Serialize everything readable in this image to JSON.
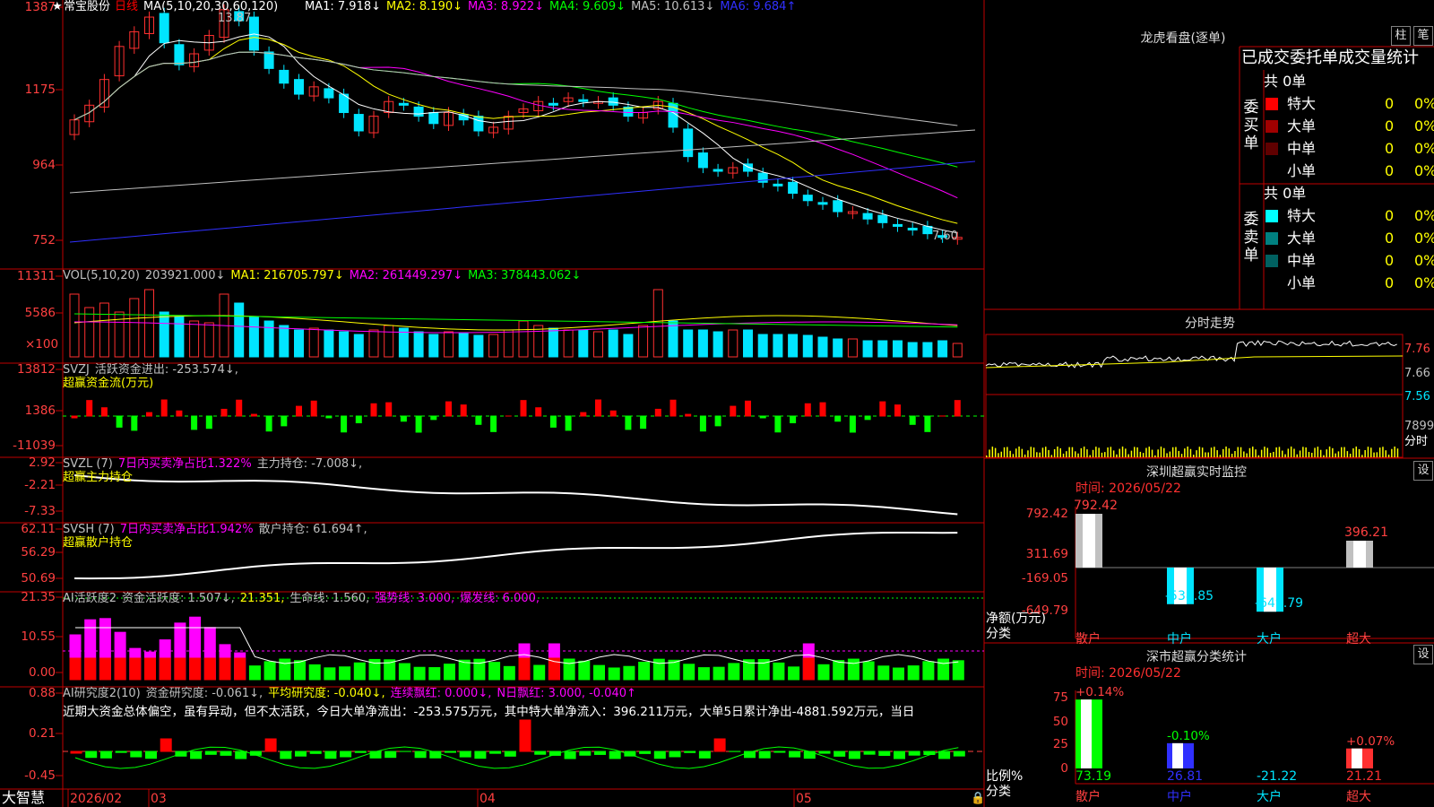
{
  "stock": {
    "name": "常宝股份",
    "period": "日线",
    "ma_header": "MA(5,10,20,30,60,120)",
    "ma_values": [
      {
        "label": "MA1: 7.918↓",
        "color": "#ffffff"
      },
      {
        "label": "MA2: 8.190↓",
        "color": "#ffff00"
      },
      {
        "label": "MA3: 8.922↓",
        "color": "#ff00ff"
      },
      {
        "label": "MA4: 9.609↓",
        "color": "#00ff00"
      },
      {
        "label": "MA5: 10.613↓",
        "color": "#c0c0c0"
      },
      {
        "label": "MA6: 9.684↑",
        "color": "#3030ff"
      }
    ],
    "high_label": "13.87",
    "low_label": "7.60"
  },
  "price_axis": [
    "1387",
    "1175",
    "964",
    "752"
  ],
  "vol_axis": [
    "11311",
    "5586",
    "×100"
  ],
  "vol_header": [
    {
      "label": "VOL(5,10,20)",
      "color": "#c0c0c0"
    },
    {
      "label": "203921.000↓",
      "color": "#c0c0c0"
    },
    {
      "label": "MA1: 216705.797↓",
      "color": "#ffff00"
    },
    {
      "label": "MA2: 261449.297↓",
      "color": "#ff00ff"
    },
    {
      "label": "MA3: 378443.062↓",
      "color": "#00ff00"
    }
  ],
  "svzj": {
    "axis": [
      "13812",
      "1386",
      "-11039"
    ],
    "header": [
      {
        "label": "SVZJ",
        "color": "#c0c0c0"
      },
      {
        "label": "活跃资金进出: -253.574↓,",
        "color": "#c0c0c0"
      }
    ],
    "sub": "超赢资金流(万元)"
  },
  "svzl": {
    "axis": [
      "2.92",
      "-2.21",
      "-7.33"
    ],
    "header": [
      {
        "label": "SVZL (7)",
        "color": "#c0c0c0"
      },
      {
        "label": "7日内买卖净占比1.322%",
        "color": "#ff00ff"
      },
      {
        "label": "主力持仓: -7.008↓,",
        "color": "#c0c0c0"
      }
    ],
    "sub": "超赢主力持仓"
  },
  "svsh": {
    "axis": [
      "62.11",
      "56.29",
      "50.69"
    ],
    "header": [
      {
        "label": "SVSH (7)",
        "color": "#c0c0c0"
      },
      {
        "label": "7日内买卖净占比1.942%",
        "color": "#ff00ff"
      },
      {
        "label": "散户持仓: 61.694↑,",
        "color": "#c0c0c0"
      }
    ],
    "sub": "超赢散户持仓"
  },
  "ai_active": {
    "axis": [
      "21.35",
      "10.55",
      "0.00"
    ],
    "header": [
      {
        "label": "AI活跃度2",
        "color": "#c0c0c0"
      },
      {
        "label": "资金活跃度: 1.507↓,",
        "color": "#c0c0c0"
      },
      {
        "label": "21.351,",
        "color": "#ffff00"
      },
      {
        "label": "生命线: 1.560,",
        "color": "#c0c0c0"
      },
      {
        "label": "强势线: 3.000,",
        "color": "#ff00ff"
      },
      {
        "label": "爆发线: 6.000,",
        "color": "#ff00ff"
      }
    ]
  },
  "ai_research": {
    "axis": [
      "0.88",
      "0.21",
      "-0.45"
    ],
    "header": [
      {
        "label": "AI研究度2(10)",
        "color": "#c0c0c0"
      },
      {
        "label": "资金研究度: -0.061↓,",
        "color": "#c0c0c0"
      },
      {
        "label": "平均研究度: -0.040↓,",
        "color": "#ffff00"
      },
      {
        "label": "连续飘红: 0.000↓,",
        "color": "#ff00ff"
      },
      {
        "label": "N日飘红: 3.000, -0.040↑",
        "color": "#ff00ff"
      }
    ],
    "text": "近期大资金总体偏空，虽有异动，但不太活跃，今日大单净流出：-253.575万元，其中特大单净流入：396.211万元，大单5日累计净出-4881.592万元，当日"
  },
  "dates": [
    "2026/02",
    "03",
    "04",
    "05"
  ],
  "brand": "大智慧",
  "lhb": {
    "title": "龙虎看盘(逐单)",
    "btn1": "柱",
    "btn2": "笔",
    "subtitle": "已成交委托单成交量统计",
    "buy_label": "委买单",
    "sell_label": "委卖单",
    "buy_total": "共 0单",
    "sell_total": "共 0单",
    "buy_rows": [
      {
        "name": "特大",
        "count": "0",
        "pct": "0%",
        "color": "#ff0000"
      },
      {
        "name": "大单",
        "count": "0",
        "pct": "0%",
        "color": "#a00000"
      },
      {
        "name": "中单",
        "count": "0",
        "pct": "0%",
        "color": "#600000"
      },
      {
        "name": "小单",
        "count": "0",
        "pct": "0%",
        "color": ""
      }
    ],
    "sell_rows": [
      {
        "name": "特大",
        "count": "0",
        "pct": "0%",
        "color": "#00ffff"
      },
      {
        "name": "大单",
        "count": "0",
        "pct": "0%",
        "color": "#008080"
      },
      {
        "name": "中单",
        "count": "0",
        "pct": "0%",
        "color": "#006060"
      },
      {
        "name": "小单",
        "count": "0",
        "pct": "0%",
        "color": ""
      }
    ]
  },
  "intraday": {
    "title": "分时走势",
    "axis": [
      "7.76",
      "7.66",
      "7.56",
      "7899",
      "分时"
    ]
  },
  "sz_monitor": {
    "title": "深圳超赢实时监控",
    "btn": "设",
    "time": "时间: 2026/05/22",
    "axis": [
      "792.42",
      "311.69",
      "-169.05",
      "-649.79"
    ],
    "ylabel1": "净额(万元)",
    "ylabel2": "分类",
    "categories": [
      "散户",
      "中户",
      "大户",
      "超大"
    ],
    "values": [
      "792.42",
      "-538.85",
      "-649.79",
      "396.21"
    ]
  },
  "sz_class": {
    "title": "深市超赢分类统计",
    "btn": "设",
    "time": "时间: 2026/05/22",
    "axis": [
      "75",
      "50",
      "25",
      "0"
    ],
    "ylabel1": "比例%",
    "ylabel2": "分类",
    "categories": [
      "散户",
      "中户",
      "大户",
      "超大"
    ],
    "top_values": [
      "+0.14%",
      "",
      "-0.10%",
      "",
      "+0.07%"
    ],
    "values": [
      "73.19",
      "26.81",
      "-21.22",
      "21.21"
    ]
  },
  "chart_data": {
    "type": "bar",
    "title": "深圳超赢实时监控",
    "categories": [
      "散户",
      "中户",
      "大户",
      "超大"
    ],
    "values": [
      792.42,
      -538.85,
      -649.79,
      396.21
    ],
    "ylabel": "净额(万元)",
    "ylim": [
      -649.79,
      792.42
    ]
  }
}
